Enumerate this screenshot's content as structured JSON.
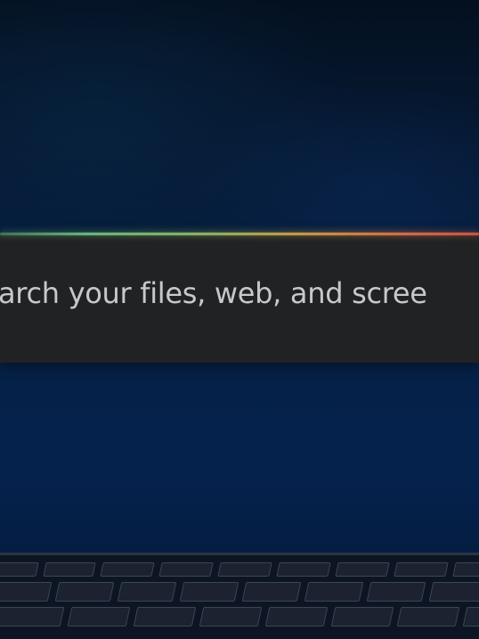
{
  "launcher": {
    "search_placeholder": "arch your files, web, and scree"
  },
  "icons": {
    "keyboard": "keyboard-keys"
  },
  "colors": {
    "launcher_bg": "#212224",
    "wallpaper_dark": "#04101f",
    "wallpaper_blue": "#05224c",
    "glow_start": "#6cc487",
    "glow_end": "#d85a46",
    "placeholder_text": "#c6c8ca"
  }
}
